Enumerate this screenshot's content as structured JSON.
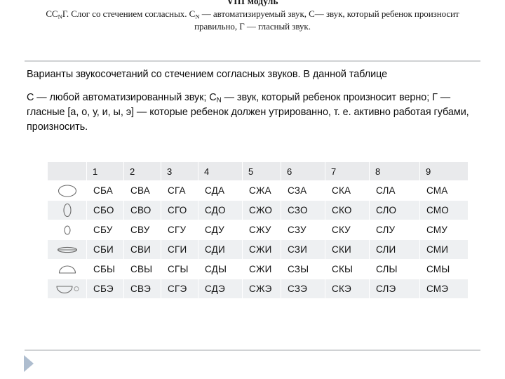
{
  "heading": {
    "module_title": "VIII модуль",
    "subtitle_part1": "CC",
    "subtitle_sub1": "N",
    "subtitle_part2": "Г. Слог со стечением согласных. C",
    "subtitle_sub2": "N",
    "subtitle_part3": " — автоматизируемый звук, С— звук, который ребенок произносит правильно, Г — гласный звук."
  },
  "body": {
    "paragraph1": "Варианты звукосочетаний со стечением согласных звуков. В данной таблице",
    "paragraph2_part1": "С — любой автоматизированный звук; С",
    "paragraph2_sub": "N",
    "paragraph2_part2": " — звук, который ребенок произносит верно; Г — гласные [а, о, у, и, ы, э] — которые ребенок должен утрированно, т. е. активно работая губами, произносить."
  },
  "table": {
    "corner_header": "",
    "column_headers": [
      "1",
      "2",
      "3",
      "4",
      "5",
      "6",
      "7",
      "8",
      "9"
    ],
    "rows": [
      {
        "icon": "mouth-wide-oval-icon",
        "vowel": "А",
        "cells": [
          "СБА",
          "СВА",
          "СГА",
          "СДА",
          "СЖА",
          "СЗА",
          "СКА",
          "СЛА",
          "СМА"
        ]
      },
      {
        "icon": "mouth-tall-narrow-oval-icon",
        "vowel": "О",
        "cells": [
          "СБО",
          "СВО",
          "СГО",
          "СДО",
          "СЖО",
          "СЗО",
          "СКО",
          "СЛО",
          "СМО"
        ]
      },
      {
        "icon": "mouth-small-oval-icon",
        "vowel": "У",
        "cells": [
          "СБУ",
          "СВУ",
          "СГУ",
          "СДУ",
          "СЖУ",
          "СЗУ",
          "СКУ",
          "СЛУ",
          "СМУ"
        ]
      },
      {
        "icon": "mouth-flat-ellipse-icon",
        "vowel": "И",
        "cells": [
          "СБИ",
          "СВИ",
          "СГИ",
          "СДИ",
          "СЖИ",
          "СЗИ",
          "СКИ",
          "СЛИ",
          "СМИ"
        ]
      },
      {
        "icon": "mouth-dome-icon",
        "vowel": "Ы",
        "cells": [
          "СБЫ",
          "СВЫ",
          "СГЫ",
          "СДЫ",
          "СЖИ",
          "СЗЫ",
          "СКЫ",
          "СЛЫ",
          "СМЫ"
        ]
      },
      {
        "icon": "mouth-bowl-icon",
        "vowel": "Э",
        "cells": [
          "СБЭ",
          "СВЭ",
          "СГЭ",
          "СДЭ",
          "СЖЭ",
          "СЗЭ",
          "СКЭ",
          "СЛЭ",
          "СМЭ"
        ]
      }
    ]
  },
  "navigation": {
    "next_label": "next-slide"
  },
  "colors": {
    "header_fill": "#e9eaec",
    "row_alt_fill": "#eef0f2",
    "divider": "#d0d2d4",
    "nav_triangle": "#aebdcf",
    "text": "#0d0d0d"
  }
}
